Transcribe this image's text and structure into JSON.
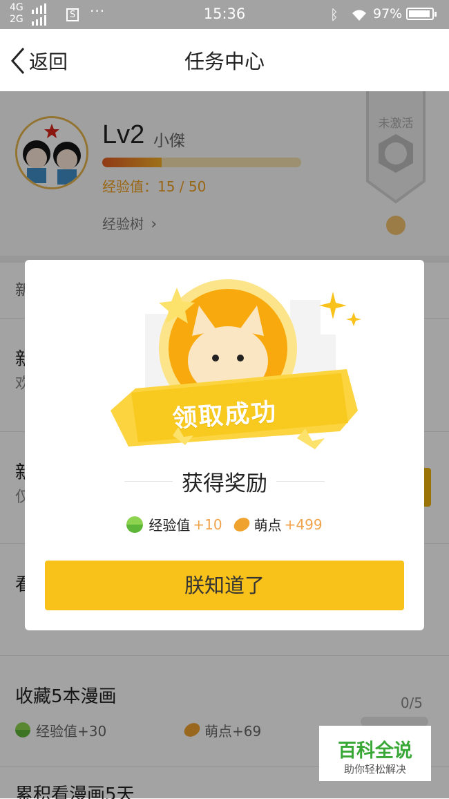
{
  "status_bar": {
    "network_top": "4G",
    "network_bottom": "2G",
    "notification_glyph": "S",
    "dots": "···",
    "time": "15:36",
    "battery": "97%"
  },
  "nav": {
    "back_label": "返回",
    "title": "任务中心"
  },
  "profile": {
    "level": "Lv2",
    "username": "小傑",
    "xp_text": "经验值：15 / 50",
    "xp_current": 15,
    "xp_max": 50,
    "tree_link": "经验树",
    "badge_status": "未激活"
  },
  "section_tab": "新",
  "tasks": [
    {
      "title": "新",
      "subtitle": "欢"
    },
    {
      "title": "新",
      "subtitle": "仅"
    },
    {
      "title": "看"
    },
    {
      "title": "收藏5本漫画",
      "progress": "0/5",
      "reward_xp": "经验值+30",
      "reward_beans": "萌点+69"
    },
    {
      "title": "累积看漫画5天"
    }
  ],
  "dialog": {
    "banner": "领取成功",
    "reward_title": "获得奖励",
    "reward_xp_label": "经验值",
    "reward_xp_amount": "+10",
    "reward_beans_label": "萌点",
    "reward_beans_amount": "+499",
    "confirm": "朕知道了"
  },
  "watermark": {
    "title": "百科全说",
    "subtitle": "助你轻松解决"
  },
  "colors": {
    "accent": "#f8c21b",
    "xp_gradient_start": "#e35c25",
    "xp_gradient_end": "#f6b027",
    "reward_amount": "#f0a34a"
  }
}
